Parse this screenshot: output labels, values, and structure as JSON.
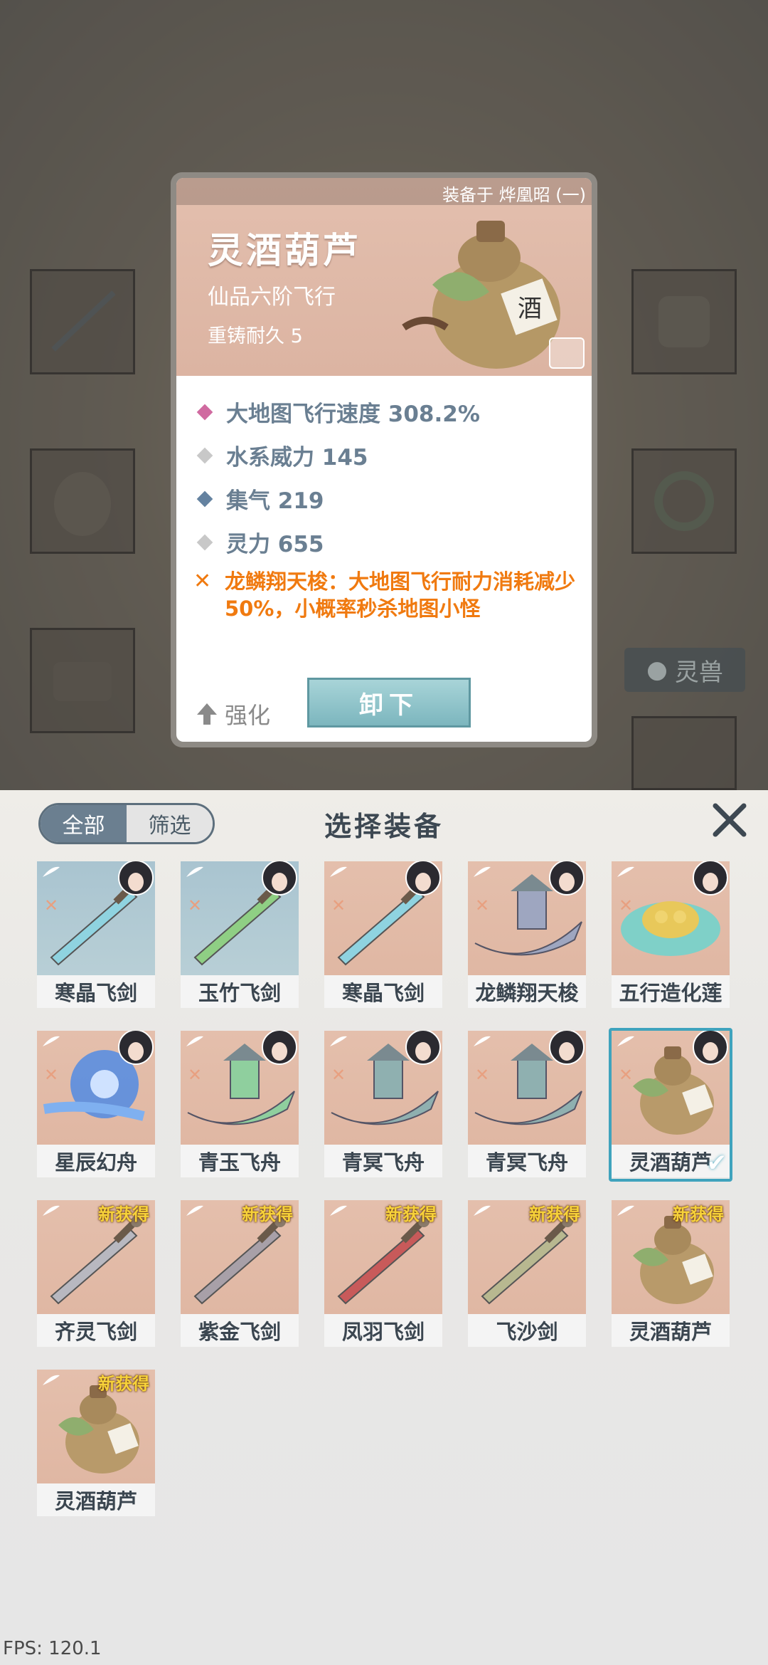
{
  "card": {
    "equipped_on": "装备于 烨凰昭 (一)",
    "name": "灵酒葫芦",
    "grade": "仙品六阶飞行",
    "durability": "重铸耐久 5",
    "stats": [
      {
        "text": "大地图飞行速度 308.2%",
        "color": "#d06aa0"
      },
      {
        "text": "水系威力 145",
        "color": "#c8c8c8"
      },
      {
        "text": "集气 219",
        "color": "#6482a0"
      },
      {
        "text": "灵力 655",
        "color": "#c8c8c8"
      }
    ],
    "skill": "龙鳞翔天梭：大地图飞行耐力消耗减少50%，小概率秒杀地图小怪",
    "enhance_label": "强化",
    "unequip_label": "卸下"
  },
  "background": {
    "spirit_beast_tab": "灵兽"
  },
  "panel": {
    "filter_all": "全部",
    "filter_screen": "筛选",
    "title": "选择装备",
    "close_icon": "close-x-icon"
  },
  "items": [
    {
      "name": "寒晶飞剑",
      "bg": "blue",
      "kind": "sword",
      "color": "#8fd3e0",
      "portrait": true,
      "new": false
    },
    {
      "name": "玉竹飞剑",
      "bg": "blue",
      "kind": "sword",
      "color": "#8fcf84",
      "portrait": true,
      "new": false
    },
    {
      "name": "寒晶飞剑",
      "bg": "pink",
      "kind": "sword",
      "color": "#8fd3e0",
      "portrait": true,
      "new": false
    },
    {
      "name": "龙鳞翔天梭",
      "bg": "pink",
      "kind": "boat",
      "color": "#9ea6c0",
      "portrait": true,
      "new": false
    },
    {
      "name": "五行造化莲",
      "bg": "pink",
      "kind": "lotus",
      "color": "#7fd0c8",
      "portrait": true,
      "new": false
    },
    {
      "name": "星辰幻舟",
      "bg": "pink",
      "kind": "orb",
      "color": "#5a8ee0",
      "portrait": true,
      "new": false
    },
    {
      "name": "青玉飞舟",
      "bg": "pink",
      "kind": "boat",
      "color": "#8fcf9e",
      "portrait": true,
      "new": false
    },
    {
      "name": "青冥飞舟",
      "bg": "pink",
      "kind": "boat",
      "color": "#8fb0b0",
      "portrait": true,
      "new": false
    },
    {
      "name": "青冥飞舟",
      "bg": "pink",
      "kind": "boat",
      "color": "#8fb0b0",
      "portrait": true,
      "new": false
    },
    {
      "name": "灵酒葫芦",
      "bg": "pink",
      "kind": "gourd",
      "color": "#b89a6a",
      "portrait": true,
      "new": false,
      "selected": true
    },
    {
      "name": "齐灵飞剑",
      "bg": "pink",
      "kind": "sword",
      "color": "#b8b8c0",
      "portrait": false,
      "new": true
    },
    {
      "name": "紫金飞剑",
      "bg": "pink",
      "kind": "sword",
      "color": "#a8a0a8",
      "portrait": false,
      "new": true
    },
    {
      "name": "凤羽飞剑",
      "bg": "pink",
      "kind": "sword",
      "color": "#c85a5a",
      "portrait": false,
      "new": true
    },
    {
      "name": "飞沙剑",
      "bg": "pink",
      "kind": "sword",
      "color": "#b8b890",
      "portrait": false,
      "new": true
    },
    {
      "name": "灵酒葫芦",
      "bg": "pink",
      "kind": "gourd",
      "color": "#b89a6a",
      "portrait": false,
      "new": true
    },
    {
      "name": "灵酒葫芦",
      "bg": "pink",
      "kind": "gourd",
      "color": "#b89a6a",
      "portrait": false,
      "new": true
    }
  ],
  "new_tag": "新获得",
  "fps": "FPS: 120.1"
}
